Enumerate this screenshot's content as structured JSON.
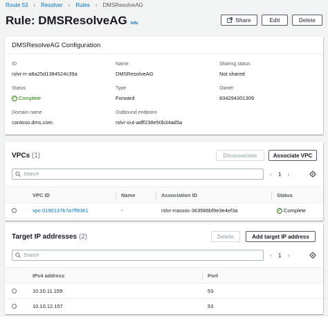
{
  "breadcrumb": {
    "items": [
      "Route 53",
      "Resolver",
      "Rules"
    ],
    "current": "DMSResolveAG"
  },
  "header": {
    "title": "Rule: DMSResolveAG",
    "info": "Info",
    "share_label": "Share",
    "edit_label": "Edit",
    "delete_label": "Delete"
  },
  "config": {
    "title": "DMSResolveAG Configuration",
    "id_label": "ID",
    "id_value": "rslvr-rr-a8a25d1384524c39a",
    "name_label": "Name",
    "name_value": "DMSResolveAG",
    "sharing_label": "Sharing status",
    "sharing_value": "Not shared",
    "status_label": "Status",
    "status_value": "Complete",
    "type_label": "Type",
    "type_value": "Forward",
    "owner_label": "Owner",
    "owner_value": "834294301309",
    "domain_label": "Domain name",
    "domain_value": "contoso.dms.com.",
    "endpoint_label": "Outbound endpoint",
    "endpoint_value": "rslvr-out-adff238e50b34ad5a"
  },
  "vpcs": {
    "title": "VPCs",
    "count": "(1)",
    "disassociate_label": "Disassociate",
    "associate_label": "Associate VPC",
    "search_placeholder": "Search",
    "page": "1",
    "columns": [
      "VPC ID",
      "Name",
      "Association ID",
      "Status"
    ],
    "rows": [
      {
        "vpc_id": "vpc-0190137b7a7ff8361",
        "name": "-",
        "association_id": "rslvr-rrassoc-363586bf9e3e4ef3a",
        "status": "Complete"
      }
    ]
  },
  "targets": {
    "title": "Target IP addresses",
    "count": "(2)",
    "delete_label": "Delete",
    "add_label": "Add target IP address",
    "search_placeholder": "Search",
    "page": "1",
    "columns": [
      "IPv4 address",
      "Port"
    ],
    "rows": [
      {
        "ip": "10.10.11.159",
        "port": "53"
      },
      {
        "ip": "10.10.12.157",
        "port": "53"
      }
    ]
  },
  "colors": {
    "link": "#0073bb",
    "success": "#1d8102",
    "background": "#f2f3f3"
  }
}
